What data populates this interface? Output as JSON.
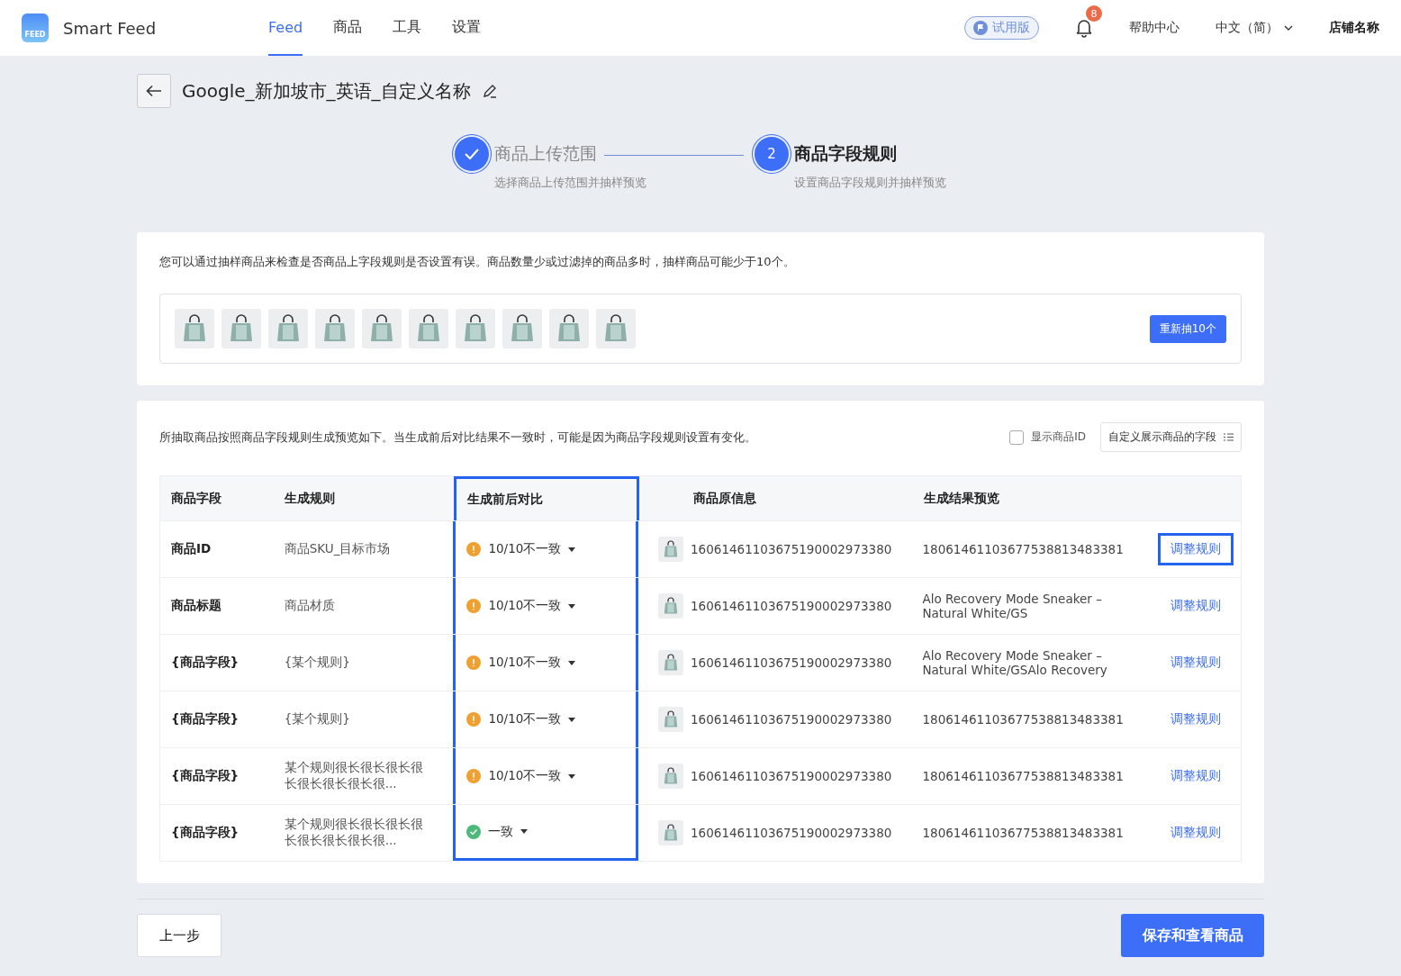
{
  "header": {
    "logo_text": "FEED",
    "app_name": "Smart Feed",
    "nav": [
      {
        "label": "Feed",
        "selected": true
      },
      {
        "label": "商品",
        "selected": false
      },
      {
        "label": "工具",
        "selected": false
      },
      {
        "label": "设置",
        "selected": false
      }
    ],
    "trial_badge": "试用版",
    "notification_count": "8",
    "help": "帮助中心",
    "language": "中文（简）",
    "shop": "店铺名称"
  },
  "page_title": "Google_新加坡市_英语_自定义名称",
  "steps": [
    {
      "title": "商品上传范围",
      "subtitle": "选择商品上传范围并抽样预览",
      "done": true
    },
    {
      "number": "2",
      "title": "商品字段规则",
      "subtitle": "设置商品字段规则并抽样预览",
      "done": false
    }
  ],
  "sample_card": {
    "note": "您可以通过抽样商品来检查是否商品上字段规则是否设置有误。商品数量少或过滤掉的商品多时，抽样商品可能少于10个。",
    "resample_button": "重新抽10个"
  },
  "preview_card": {
    "note": "所抽取商品按照商品字段规则生成预览如下。当生成前后对比结果不一致时，可能是因为商品字段规则设置有变化。",
    "show_id": {
      "label": "显示商品ID",
      "checked": false
    },
    "customize_button": "自定义展示商品的字段",
    "columns": [
      {
        "label": "商品字段",
        "highlighted": false
      },
      {
        "label": "生成规则",
        "highlighted": false
      },
      {
        "label": "生成前后对比",
        "highlighted": true
      },
      {
        "label": "商品原信息",
        "highlighted": false
      },
      {
        "label": "生成结果预览",
        "highlighted": false
      }
    ],
    "rows": [
      {
        "field": "商品ID",
        "rule": "商品SKU_目标市场",
        "status": "10/10不一致",
        "kind": "warning",
        "original": "16061461103675190002973380",
        "preview": "18061461103677538813483381",
        "action": "调整规则",
        "highlighted": true
      },
      {
        "field": "商品标题",
        "rule": "商品材质",
        "status": "10/10不一致",
        "kind": "warning",
        "original": "16061461103675190002973380",
        "preview": "Alo Recovery Mode Sneaker – Natural White/GS",
        "action": "调整规则",
        "highlighted": false
      },
      {
        "field": "{商品字段}",
        "rule": "{某个规则}",
        "status": "10/10不一致",
        "kind": "warning",
        "original": "16061461103675190002973380",
        "preview": "Alo Recovery Mode Sneaker – Natural White/GSAlo Recovery",
        "action": "调整规则",
        "highlighted": false
      },
      {
        "field": "{商品字段}",
        "rule": "{某个规则}",
        "status": "10/10不一致",
        "kind": "warning",
        "original": "16061461103675190002973380",
        "preview": "18061461103677538813483381",
        "action": "调整规则",
        "highlighted": false
      },
      {
        "field": "{商品字段}",
        "rule": "某个规则很长很长很长很长很长很长很长很...",
        "status": "10/10不一致",
        "kind": "warning",
        "original": "16061461103675190002973380",
        "preview": "18061461103677538813483381",
        "action": "调整规则",
        "highlighted": false
      },
      {
        "field": "{商品字段}",
        "rule": "某个规则很长很长很长很长很长很长很长很...",
        "status": "一致",
        "kind": "ok",
        "original": "16061461103675190002973380",
        "preview": "18061461103677538813483381",
        "action": "调整规则",
        "highlighted": false
      }
    ]
  },
  "footer": {
    "back_button": "上一步",
    "save_button": "保存和查看商品"
  }
}
